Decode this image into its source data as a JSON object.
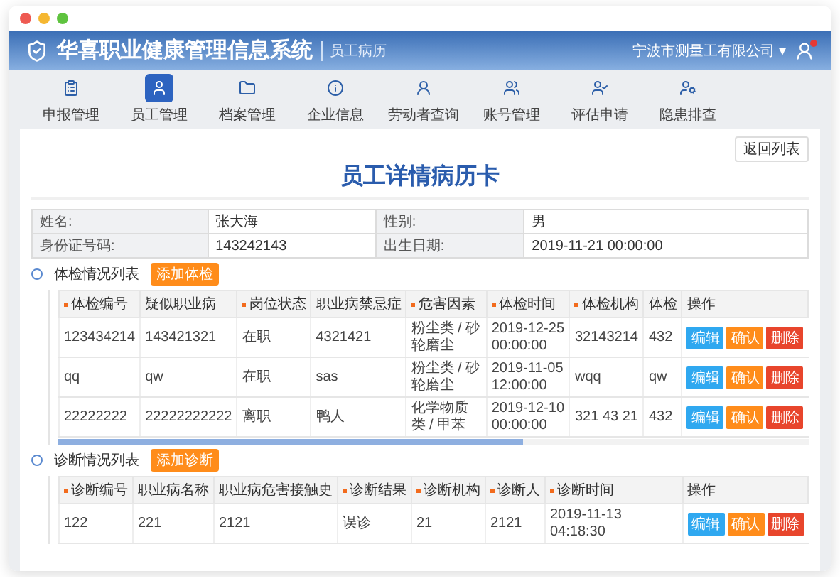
{
  "browser": {
    "dots": [
      {
        "color": "#ee5a52"
      },
      {
        "color": "#f5b731"
      },
      {
        "color": "#5fc33f"
      }
    ]
  },
  "header": {
    "title": "华喜职业健康管理信息系统",
    "subtitle": "员工病历",
    "company": "宁波市测量工有限公司",
    "caret": "▾",
    "notification": true
  },
  "nav": [
    {
      "label": "申报管理",
      "selected": false
    },
    {
      "label": "员工管理",
      "selected": true
    },
    {
      "label": "档案管理",
      "selected": false
    },
    {
      "label": "企业信息",
      "selected": false
    },
    {
      "label": "劳动者查询",
      "selected": false
    },
    {
      "label": "账号管理",
      "selected": false
    },
    {
      "label": "评估申请",
      "selected": false
    },
    {
      "label": "隐患排查",
      "selected": false
    }
  ],
  "card": {
    "back_button": "返回列表",
    "title": "员工详情病历卡"
  },
  "info": [
    [
      {
        "label": "姓名:",
        "value": "张大海"
      },
      {
        "label": "性别:",
        "value": "男"
      }
    ],
    [
      {
        "label": "身份证号码:",
        "value": "143242143"
      },
      {
        "label": "出生日期:",
        "value": "2019-11-21 00:00:00"
      }
    ]
  ],
  "sections": [
    {
      "title": "体检情况列表",
      "add_button": "添加体检",
      "scrollbar": true,
      "columns": [
        {
          "label": "体检编号",
          "marked": true
        },
        {
          "label": "疑似职业病",
          "marked": false
        },
        {
          "label": "岗位状态",
          "marked": true
        },
        {
          "label": "职业病禁忌症",
          "marked": false
        },
        {
          "label": "危害因素",
          "marked": true
        },
        {
          "label": "体检时间",
          "marked": true
        },
        {
          "label": "体检机构",
          "marked": true
        },
        {
          "label": "体检",
          "marked": false
        },
        {
          "label": "操作",
          "marked": false
        }
      ],
      "rows": [
        {
          "cells": [
            "123434214",
            "143421321",
            "在职",
            "4321421",
            "粉尘类 / 砂轮磨尘",
            "2019-12-25 00:00:00",
            "32143214",
            "432"
          ],
          "actions": [
            {
              "label": "编辑",
              "kind": "edit"
            },
            {
              "label": "确认",
              "kind": "confirm"
            },
            {
              "label": "删除",
              "kind": "delete"
            }
          ]
        },
        {
          "cells": [
            "qq",
            "qw",
            "在职",
            "sas",
            "粉尘类 / 砂轮磨尘",
            "2019-11-05 12:00:00",
            "wqq",
            "qw"
          ],
          "actions": [
            {
              "label": "编辑",
              "kind": "edit"
            },
            {
              "label": "确认",
              "kind": "confirm"
            },
            {
              "label": "删除",
              "kind": "delete"
            }
          ]
        },
        {
          "cells": [
            "22222222",
            "22222222222",
            "离职",
            "鸭人",
            "化学物质类 / 甲苯",
            "2019-12-10 00:00:00",
            "321 43 21",
            "432"
          ],
          "actions": [
            {
              "label": "编辑",
              "kind": "edit"
            },
            {
              "label": "确认",
              "kind": "confirm"
            },
            {
              "label": "删除",
              "kind": "delete"
            }
          ]
        }
      ]
    },
    {
      "title": "诊断情况列表",
      "add_button": "添加诊断",
      "scrollbar": false,
      "columns": [
        {
          "label": "诊断编号",
          "marked": true
        },
        {
          "label": "职业病名称",
          "marked": false
        },
        {
          "label": "职业病危害接触史",
          "marked": false
        },
        {
          "label": "诊断结果",
          "marked": true
        },
        {
          "label": "诊断机构",
          "marked": true
        },
        {
          "label": "诊断人",
          "marked": true
        },
        {
          "label": "诊断时间",
          "marked": true
        },
        {
          "label": "操作",
          "marked": false
        }
      ],
      "rows": [
        {
          "cells": [
            "122",
            "221",
            "2121",
            "误诊",
            "21",
            "2121",
            "2019-11-13 04:18:30"
          ],
          "actions": [
            {
              "label": "编辑",
              "kind": "edit"
            },
            {
              "label": "确认",
              "kind": "confirm"
            },
            {
              "label": "删除",
              "kind": "delete"
            }
          ]
        }
      ]
    }
  ]
}
